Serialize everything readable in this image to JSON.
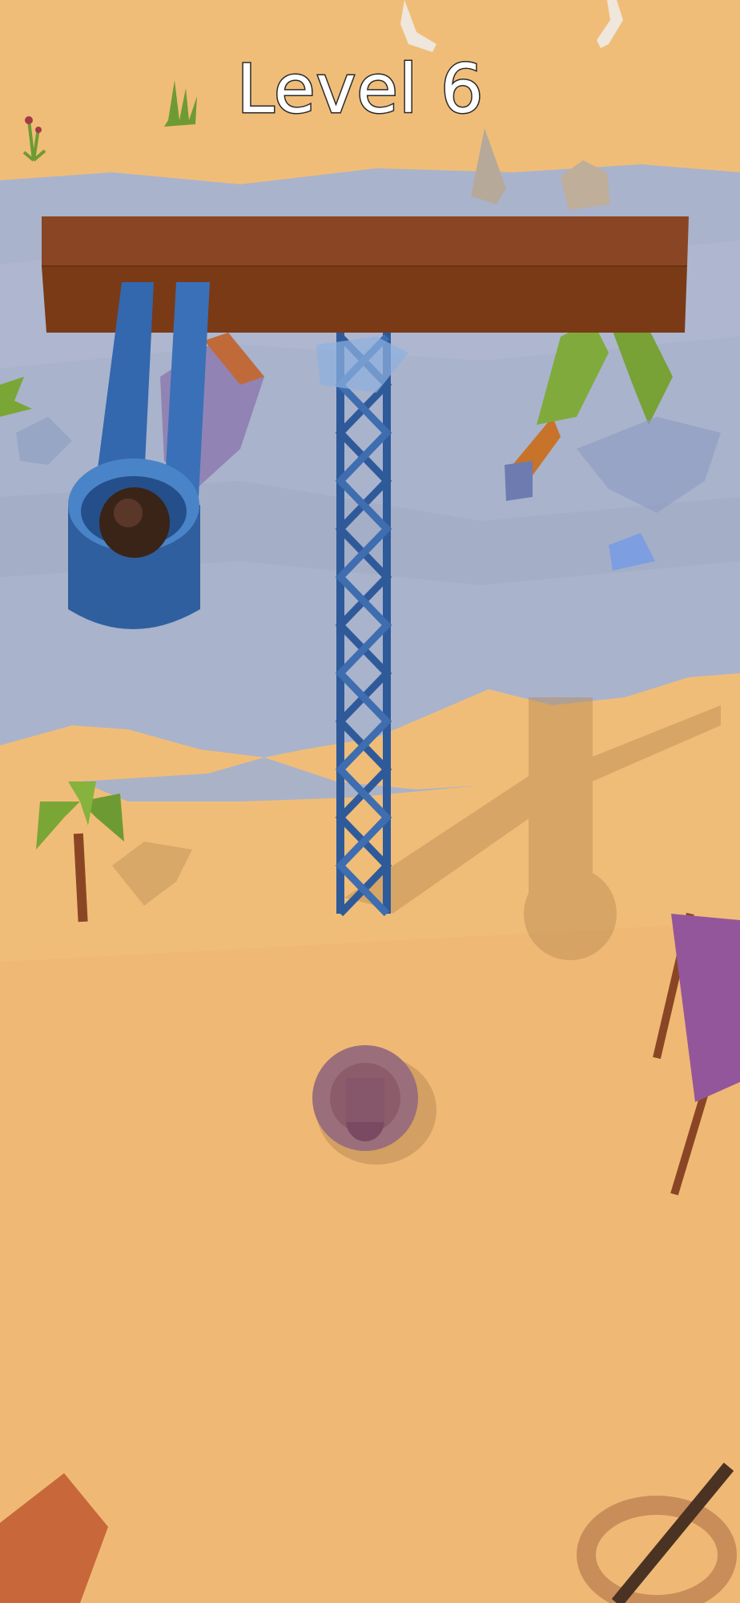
{
  "hud": {
    "level_label": "Level 6"
  },
  "scene": {
    "sand_color": "#f0bd78",
    "water_color": "#a9b3cc",
    "beam_color": "#8a4624",
    "tower_color": "#2f5a9a",
    "ball_color": "#3a2418",
    "plant_color": "#7aa636",
    "goal_color": "#9a6e7a"
  }
}
